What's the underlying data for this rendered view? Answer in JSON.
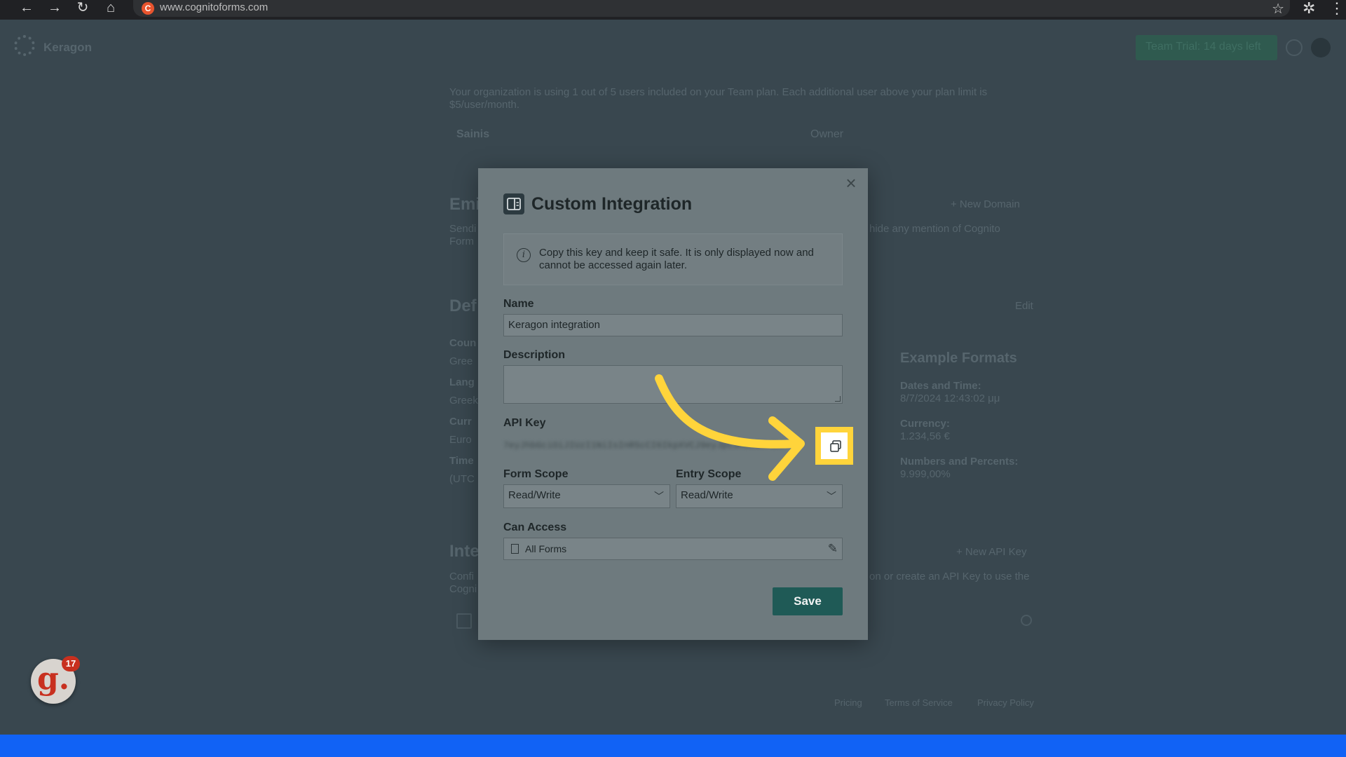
{
  "browser": {
    "url": "www.cognitoforms.com",
    "back": "←",
    "forward": "→",
    "reload": "↻",
    "home": "⌂",
    "star": "☆",
    "extensions": "✲",
    "menu": "⋮"
  },
  "background": {
    "logo_text": "Keragon",
    "trial_button": "Team Trial: 14 days left",
    "users_text_line1": "Your organization is using 1 out of 5 users included on your Team plan. Each additional user above your plan limit is",
    "users_text_line2": "$5/user/month.",
    "user_name": "Sainis",
    "user_role": "Owner",
    "email_heading": "Emi",
    "email_text_line1": "Sendi",
    "email_text_right": "hide any mention of Cognito",
    "email_text_line2": "Form",
    "new_domain": "+ New Domain",
    "defaults_heading": "Def",
    "edit": "Edit",
    "country_label": "Coun",
    "country_value": "Gree",
    "language_label": "Lang",
    "language_value": "Greek",
    "currency_label": "Curr",
    "currency_value": "Euro",
    "timezone_label": "Time",
    "timezone_value": "(UTC",
    "example_formats": "Example Formats",
    "dates_label": "Dates and Time:",
    "dates_value": "8/7/2024 12:43:02 μμ",
    "currency_ex_label": "Currency:",
    "currency_ex_value": "1.234,56 €",
    "numbers_label": "Numbers and Percents:",
    "numbers_value": "9.999,00%",
    "integrations_heading": "Inte",
    "integrations_text_line1": "Confi",
    "integrations_text_right": "on or create an API Key to use the",
    "integrations_text_line2": "Cogni",
    "new_api_key": "+ New API Key",
    "footer_pricing": "Pricing",
    "footer_terms": "Terms of Service",
    "footer_privacy": "Privacy Policy",
    "badge_letter": "g.",
    "badge_count": "17"
  },
  "modal": {
    "title": "Custom Integration",
    "close": "×",
    "info_text": "Copy this key and keep it safe. It is only displayed now and cannot be accessed again later.",
    "name_label": "Name",
    "name_value": "Keragon integration",
    "description_label": "Description",
    "api_key_label": "API Key",
    "api_key_value": "7eyJhbGciOiJIUzI1NiIsInR5cCI6IkpXVCJ9eyJpc3MiOiJrZXJhZ29uIn0",
    "form_scope_label": "Form Scope",
    "form_scope_value": "Read/Write",
    "entry_scope_label": "Entry Scope",
    "entry_scope_value": "Read/Write",
    "can_access_label": "Can Access",
    "can_access_value": "All Forms",
    "save_label": "Save"
  },
  "colors": {
    "highlight": "#ffd43b",
    "save_button": "#1f5a56",
    "bottom_bar": "#1162f5"
  }
}
